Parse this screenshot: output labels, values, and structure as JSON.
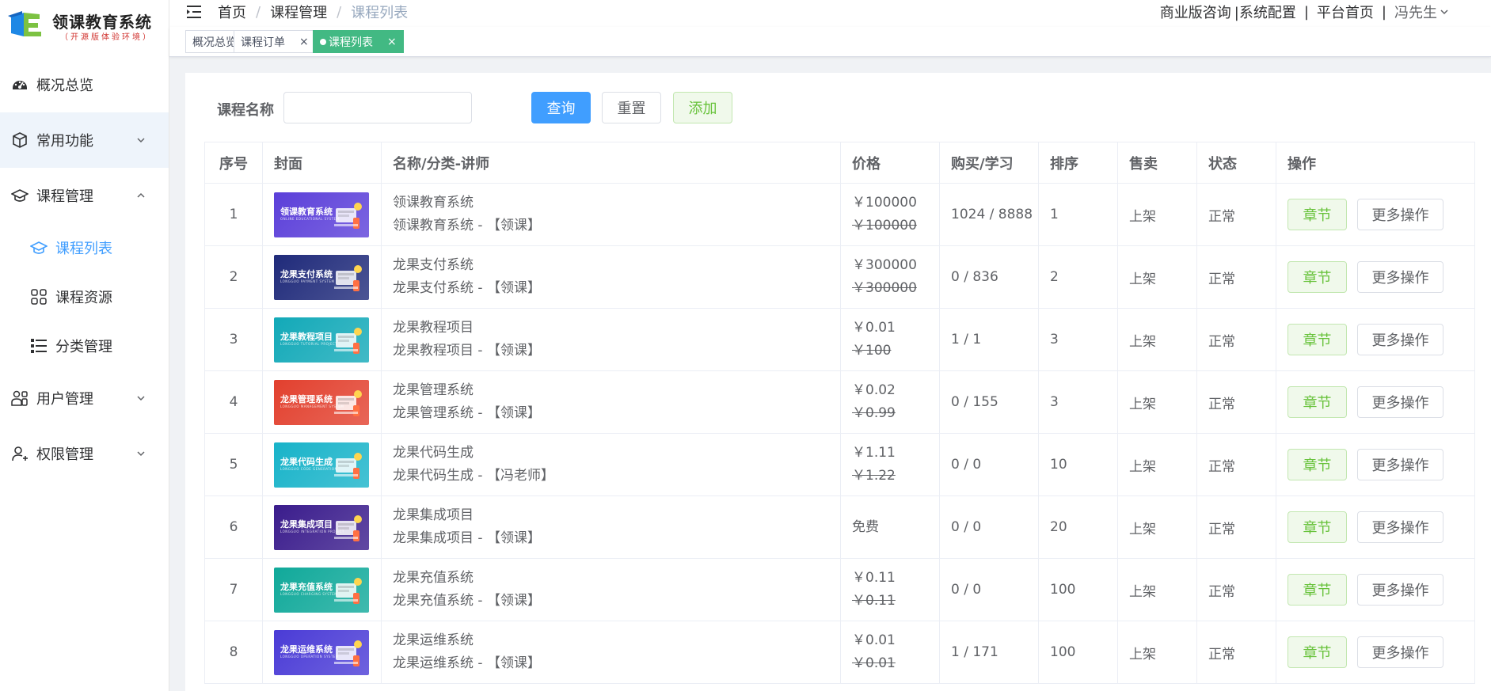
{
  "logo": {
    "title": "领课教育系统",
    "subtitle": "（开源版体验环境）"
  },
  "sidebar": {
    "items": [
      {
        "label": "概况总览",
        "icon": "dashboard-icon"
      },
      {
        "label": "常用功能",
        "icon": "cube-icon",
        "expanded": false
      },
      {
        "label": "课程管理",
        "icon": "graduation-cap-icon",
        "expanded": true,
        "children": [
          {
            "label": "课程列表",
            "icon": "graduation-cap-icon",
            "selected": true
          },
          {
            "label": "课程资源",
            "icon": "grid-icon"
          },
          {
            "label": "分类管理",
            "icon": "list-icon"
          }
        ]
      },
      {
        "label": "用户管理",
        "icon": "users-icon",
        "expanded": false
      },
      {
        "label": "权限管理",
        "icon": "user-lock-icon",
        "expanded": false
      }
    ]
  },
  "header": {
    "breadcrumb": [
      "首页",
      "课程管理",
      "课程列表"
    ],
    "links": [
      "商业版咨询",
      "|系统配置",
      "平台首页"
    ],
    "separator": "|",
    "user": "冯先生"
  },
  "tags": [
    {
      "label": "概况总览",
      "active": false
    },
    {
      "label": "课程订单",
      "active": false
    },
    {
      "label": "课程列表",
      "active": true
    }
  ],
  "tag_close": "×",
  "search": {
    "label": "课程名称",
    "value": "",
    "placeholder": "",
    "query_label": "查询",
    "reset_label": "重置",
    "add_label": "添加"
  },
  "table": {
    "headers": [
      "序号",
      "封面",
      "名称/分类-讲师",
      "价格",
      "购买/学习",
      "排序",
      "售卖",
      "状态",
      "操作"
    ],
    "chapter_label": "章节",
    "more_label": "更多操作",
    "rows": [
      {
        "index": "1",
        "cover_title": "领课教育系统",
        "cover_sub": "ONLINE EDUCATIONAL SYSTEM",
        "cover_color": "#5b3fd9",
        "name": "领课教育系统",
        "category": "领课教育系统 - 【领课】",
        "price": "￥100000",
        "orig_price": "￥100000",
        "buy_study": "1024 / 8888",
        "sort": "1",
        "sale": "上架",
        "status": "正常"
      },
      {
        "index": "2",
        "cover_title": "龙果支付系统",
        "cover_sub": "LONGGUO PAYMENT SYSTEM",
        "cover_color": "#1f2a7a",
        "name": "龙果支付系统",
        "category": "龙果支付系统 - 【领课】",
        "price": "￥300000",
        "orig_price": "￥300000",
        "buy_study": "0 / 836",
        "sort": "2",
        "sale": "上架",
        "status": "正常"
      },
      {
        "index": "3",
        "cover_title": "龙果教程项目",
        "cover_sub": "LONGGUO TUTORIAL PROJECT",
        "cover_color": "#12a9b8",
        "name": "龙果教程项目",
        "category": "龙果教程项目 - 【领课】",
        "price": "￥0.01",
        "orig_price": "￥100",
        "buy_study": "1 / 1",
        "sort": "3",
        "sale": "上架",
        "status": "正常"
      },
      {
        "index": "4",
        "cover_title": "龙果管理系统",
        "cover_sub": "LONGGUO MANAGEMENT SYSTEM",
        "cover_color": "#e2402e",
        "name": "龙果管理系统",
        "category": "龙果管理系统 - 【领课】",
        "price": "￥0.02",
        "orig_price": "￥0.99",
        "buy_study": "0 / 155",
        "sort": "3",
        "sale": "上架",
        "status": "正常"
      },
      {
        "index": "5",
        "cover_title": "龙果代码生成",
        "cover_sub": "LONGGUO CODE GENERATION",
        "cover_color": "#18b3c9",
        "name": "龙果代码生成",
        "category": "龙果代码生成 - 【冯老师】",
        "price": "￥1.11",
        "orig_price": "￥1.22",
        "buy_study": "0 / 0",
        "sort": "10",
        "sale": "上架",
        "status": "正常"
      },
      {
        "index": "6",
        "cover_title": "龙果集成项目",
        "cover_sub": "LONGGUO INTEGRATION PROJECT",
        "cover_color": "#3a1c8c",
        "name": "龙果集成项目",
        "category": "龙果集成项目 - 【领课】",
        "price": "免费",
        "orig_price": "",
        "buy_study": "0 / 0",
        "sort": "20",
        "sale": "上架",
        "status": "正常"
      },
      {
        "index": "7",
        "cover_title": "龙果充值系统",
        "cover_sub": "LONGGUO CHARGING SYSTEM",
        "cover_color": "#10a99a",
        "name": "龙果充值系统",
        "category": "龙果充值系统 - 【领课】",
        "price": "￥0.11",
        "orig_price": "￥0.11",
        "buy_study": "0 / 0",
        "sort": "100",
        "sale": "上架",
        "status": "正常"
      },
      {
        "index": "8",
        "cover_title": "龙果运维系统",
        "cover_sub": "LONGGUO OPERATION SYSTEM",
        "cover_color": "#4a3bd6",
        "name": "龙果运维系统",
        "category": "龙果运维系统 - 【领课】",
        "price": "￥0.01",
        "orig_price": "￥0.01",
        "buy_study": "1 / 171",
        "sort": "100",
        "sale": "上架",
        "status": "正常"
      }
    ]
  },
  "colors": {
    "primary": "#409eff",
    "success": "#67c23a",
    "tag_active": "#42b983"
  }
}
